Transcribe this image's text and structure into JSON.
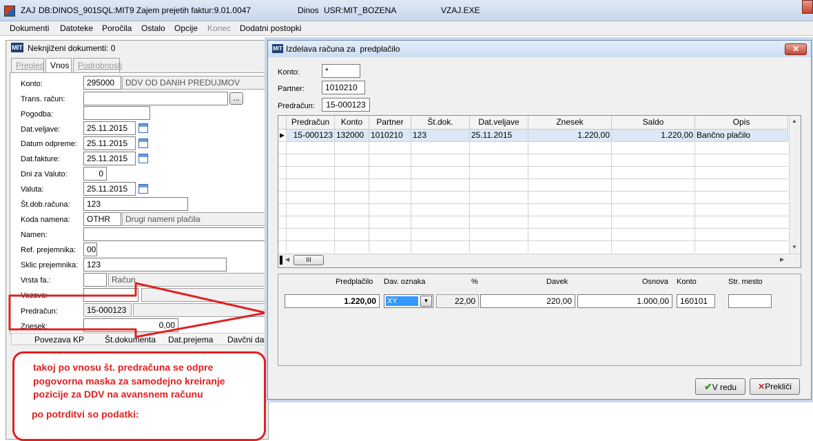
{
  "window": {
    "title_segments": [
      "ZAJ",
      "DB:DINOS_901",
      "SQL:MIT9",
      "Zajem prejetih faktur:9.01.0047",
      "Dinos",
      "USR:MIT_BOZENA",
      "VZAJ.EXE"
    ]
  },
  "menu": [
    "Dokumenti",
    "Datoteke",
    "Poročila",
    "Ostalo",
    "Opcije",
    "Konec",
    "Dodatni postopki"
  ],
  "left": {
    "header": "Neknjiženi dokumenti: 0",
    "tabs": [
      "Pregled",
      "Vnos",
      "Podrobnosti"
    ],
    "fields": {
      "konto": {
        "label": "Konto:",
        "value": "295000",
        "desc": "DDV OD DANIH PREDUJMOV"
      },
      "trans": {
        "label": "Trans. račun:",
        "btn": "..."
      },
      "pogodba": {
        "label": "Pogodba:"
      },
      "datveljave": {
        "label": "Dat.veljave:",
        "value": "25.11.2015"
      },
      "datumodpreme": {
        "label": "Datum odpreme:",
        "value": "25.11.2015"
      },
      "datfakture": {
        "label": "Dat.fakture:",
        "value": "25.11.2015"
      },
      "dni": {
        "label": "Dni za Valuto:",
        "value": "0"
      },
      "valuta": {
        "label": "Valuta:",
        "value": "25.11.2015"
      },
      "stdob": {
        "label": "Št.dob.računa:",
        "value": "123"
      },
      "koda": {
        "label": "Koda namena:",
        "value": "OTHR",
        "desc": "Drugi nameni plačila"
      },
      "namen": {
        "label": "Namen:"
      },
      "ref": {
        "label": "Ref. prejemnika:",
        "value": "00"
      },
      "sklic": {
        "label": "Sklic prejemnika:",
        "value": "123"
      },
      "vrsta": {
        "label": "Vrsta fa.:",
        "desc": "Račun"
      },
      "vezava": {
        "label": "Vezava:"
      },
      "predracun": {
        "label": "Predračun:",
        "value": "15-000123"
      },
      "znesek": {
        "label": "Znesek:",
        "value": "0,00"
      }
    },
    "table_headers": [
      "Povezava KP",
      "Št.dokumenta",
      "Dat.prejema",
      "Davčni dat."
    ]
  },
  "dialog": {
    "title": "Izdelava računa za  predplačilo",
    "konto": {
      "label": "Konto:",
      "value": "*"
    },
    "partner": {
      "label": "Partner:",
      "value": "1010210"
    },
    "predracun": {
      "label": "Predračun:",
      "value": "15-000123"
    },
    "grid_headers": [
      "Predračun",
      "Konto",
      "Partner",
      "Št.dok.",
      "Dat.veljave",
      "Znesek",
      "Saldo",
      "Opis"
    ],
    "grid_row": [
      "15-000123",
      "132000",
      "1010210",
      "123",
      "25.11.2015",
      "1.220,00",
      "1.220,00",
      "Bančno plačilo"
    ],
    "scroll_label": "III",
    "bottom_headers": [
      "Predplačilo",
      "Dav. oznaka",
      "%",
      "Davek",
      "Osnova",
      "Konto",
      "Str. mesto"
    ],
    "bottom_values": {
      "predplacilo": "1.220,00",
      "oznaka": "XY",
      "odstotek": "22,00",
      "davek": "220,00",
      "osnova": "1.000,00",
      "konto": "160101",
      "strmesto": ""
    },
    "ok_label": "V redu",
    "cancel_label": "Prekliči"
  },
  "annotation": {
    "lines": [
      "takoj po vnosu št. predračuna se odpre",
      "pogovorna maska za samodejno kreiranje",
      "pozicije za DDV na avansnem računu"
    ],
    "footer": "po potrditvi so podatki:"
  }
}
